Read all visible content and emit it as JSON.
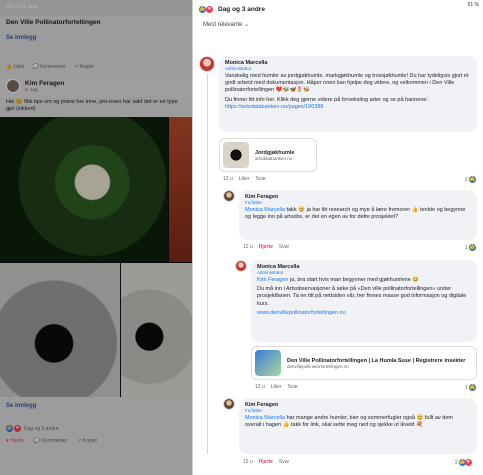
{
  "left": {
    "status_time": "09:17 23. aug.",
    "group_title": "Den Ville Pollinatorfortellingen",
    "see_more_1": "Se innlegg",
    "actions": [
      "Liker",
      "Kommenter",
      "Kopier"
    ],
    "author": "Kim Feragen",
    "author_sub": "2. aug. · ",
    "post_text": "Hei 😊 fikk tips om og prøve her inne, pro-noen har sakt det er en type gjel (sikkert)",
    "see_more_2": "Se innlegg",
    "reactions_label": "Dag og 3 andre",
    "actions_bottom": [
      "Hjerte",
      "Kommenter",
      "Kopier"
    ]
  },
  "right": {
    "status": "51 %",
    "reactions_label": "Dag og 3 andre",
    "sort_label": "Mest relevante ⌄",
    "comments": [
      {
        "name": "Monica Marcella",
        "role": "Administrator",
        "text_1": "Vanskelig med humler av jordgjøkhumle, markgjøkhumle og trossjøkhumle! Du har tydeligvis gjort et godt arbeid med dokumentasjon. Håper noen kan hjelpe deg videre, og velkommen i Den Ville pollinatorfortellingen ❤️🐝🦋🌷🐝",
        "text_2": "Du finner litt info her. Klikk deg gjerne videre på forveksling arter og se på hannene:",
        "link": "https://artsdatabanken.no/pages/190388",
        "preview_title": "Jordgjøkhumle",
        "preview_url": "artsdatabanken.no",
        "meta": [
          "12 u",
          "Liker",
          "Svar"
        ],
        "count": "2"
      },
      {
        "name": "Kim Feragen",
        "role": "Forfatter",
        "mention": "Monica Marcella",
        "text": "takk 😊 ja har litt research og mye å lære fremover 👍 tenkte og begynne og legge inn på artsobs, er det en egen av for dette prosjektet?",
        "meta": [
          "12 u",
          "Hjerte",
          "Svar"
        ],
        "count": "1"
      },
      {
        "name": "Monica Marcella",
        "role": "Administrator",
        "mention": "Kim Feragen",
        "text_1": "ja, bra start hvis man begynner med gjøkhumlene 😊",
        "text_2": "Du må inn i Artsobservasjoner å søke på «Den ville pollinatorfortellingen» under prosjektfanen. Ta en titt på nettsiden vår, her finnes masse god informasjon og digitale kurs.",
        "link": "www.denvillepollinatorfortellingen.no",
        "preview_title": "Den Ville Pollinatorfortellingen | La Humla Suse | Registrere insekter",
        "preview_url": "denvillepollinatorfortellingen.no",
        "meta": [
          "12 u",
          "Liker",
          "Svar"
        ],
        "count": "1"
      },
      {
        "name": "Kim Feragen",
        "role": "Forfatter",
        "mention": "Monica Marcella",
        "text": "har mange andre humler, bier og sommerfugler også 😊 fullt av dem overalt i hagen 👍 takk for link, skal sette meg ned og sjekke ut ikveld 💐",
        "meta": [
          "12 u",
          "Hjerte",
          "Svar"
        ],
        "count": "2"
      }
    ]
  }
}
